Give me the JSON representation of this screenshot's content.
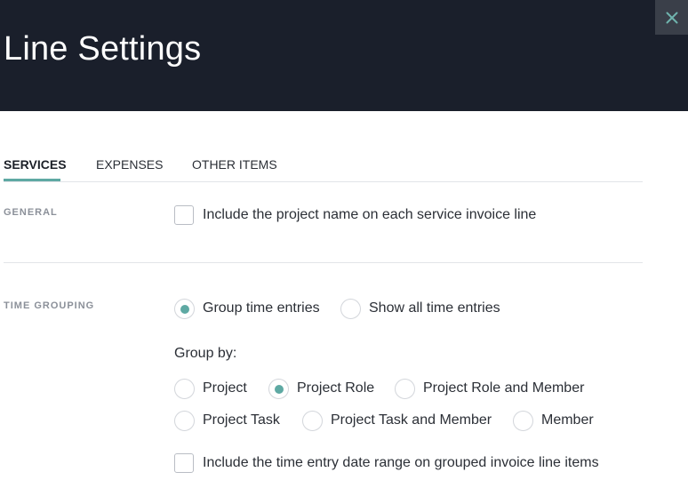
{
  "header": {
    "title": "Line Settings",
    "close_icon": "close-icon"
  },
  "tabs": [
    {
      "label": "SERVICES",
      "active": true
    },
    {
      "label": "EXPENSES",
      "active": false
    },
    {
      "label": "OTHER ITEMS",
      "active": false
    }
  ],
  "general": {
    "label": "GENERAL",
    "include_project_name": {
      "label": "Include the project name on each service invoice line",
      "checked": false
    }
  },
  "time_grouping": {
    "label": "TIME GROUPING",
    "mode_options": [
      {
        "label": "Group time entries",
        "selected": true
      },
      {
        "label": "Show all time entries",
        "selected": false
      }
    ],
    "group_by_label": "Group by:",
    "group_by_options": [
      {
        "label": "Project",
        "selected": false
      },
      {
        "label": "Project Role",
        "selected": true
      },
      {
        "label": "Project Role and Member",
        "selected": false
      },
      {
        "label": "Project Task",
        "selected": false
      },
      {
        "label": "Project Task and Member",
        "selected": false
      },
      {
        "label": "Member",
        "selected": false
      }
    ],
    "include_date_range": {
      "label": "Include the time entry date range on grouped invoice line items",
      "checked": false
    }
  },
  "colors": {
    "header_bg": "#1a1f2b",
    "accent": "#5ea9a3",
    "close_bg": "#3a3f49"
  }
}
